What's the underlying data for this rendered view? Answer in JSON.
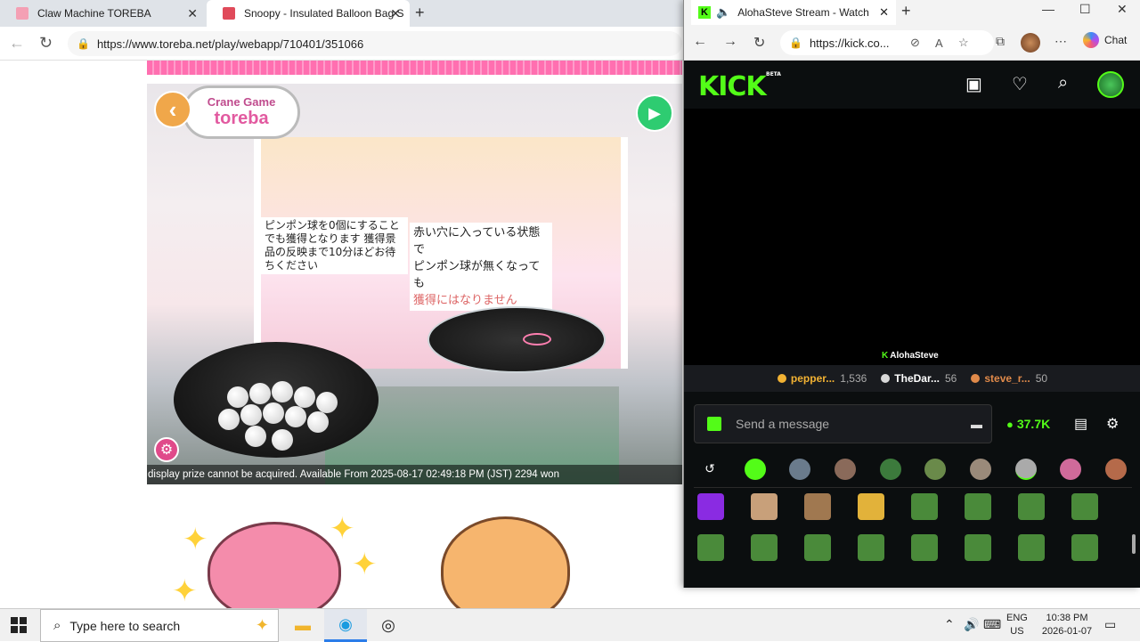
{
  "browser": {
    "tabs": [
      {
        "title": "Claw Machine TOREBA",
        "color": "#f4a0b4"
      },
      {
        "title": "Snoopy - Insulated Balloon Bag S",
        "color": "#e04a5a"
      }
    ],
    "url": "https://www.toreba.net/play/webapp/710401/351066"
  },
  "game": {
    "logo_small": "Crane Game",
    "logo_big": "toreba",
    "sign_left": "ピンポン球を0個にすることでも獲得となります 獲得景品の反映まで10分ほどお待ちください",
    "sign_right_1": "赤い穴に入っている状態で",
    "sign_right_2": "ピンポン球が無くなっても",
    "sign_right_3": "獲得にはなりません",
    "ticker": "display prize cannot be acquired. Available From 2025-08-17 02:49:18 PM (JST) 2294 won"
  },
  "kick": {
    "tab_title": "AlohaSteve Stream - Watch Live",
    "url": "https://kick.co...",
    "chat_label": "Chat",
    "logo": "KICK",
    "beta": "BETA",
    "streamer": "AlohaSteve",
    "leaderboard": [
      {
        "name": "pepper...",
        "value": "1,536",
        "color": "#f2b233"
      },
      {
        "name": "TheDar...",
        "value": "56",
        "color": "#d9d9d9"
      },
      {
        "name": "steve_r...",
        "value": "50",
        "color": "#e08a4a"
      }
    ],
    "message_placeholder": "Send a message",
    "points": "37.7K",
    "accent": "#53fc18"
  },
  "taskbar": {
    "search_placeholder": "Type here to search",
    "lang_1": "ENG",
    "lang_2": "US",
    "time": "10:38 PM",
    "date": "2026-01-07"
  }
}
